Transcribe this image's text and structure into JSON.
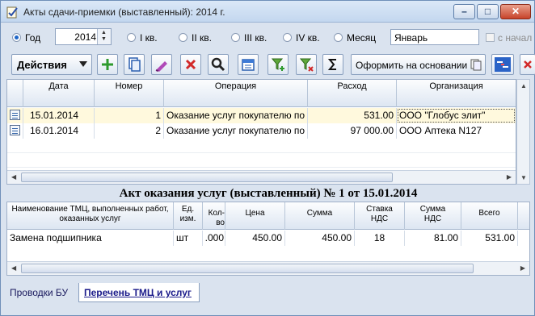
{
  "window": {
    "title": "Акты сдачи-приемки (выставленный): 2014 г.",
    "buttons": {
      "minimize": "–",
      "maximize": "□",
      "close": "✕"
    }
  },
  "filters": {
    "period_options": [
      {
        "label": "Год",
        "selected": true
      },
      {
        "label": "I кв.",
        "selected": false
      },
      {
        "label": "II кв.",
        "selected": false
      },
      {
        "label": "III кв.",
        "selected": false
      },
      {
        "label": "IV кв.",
        "selected": false
      },
      {
        "label": "Месяц",
        "selected": false
      }
    ],
    "year_value": "2014",
    "month_value": "Январь",
    "since_start_label": "с начал"
  },
  "toolbar": {
    "actions_label": "Действия",
    "basis_label": "Оформить на основании",
    "icons": [
      "add-icon",
      "copy-icon",
      "edit-icon",
      "delete-icon",
      "search-icon",
      "calendar-icon",
      "filter-add-icon",
      "filter-remove-icon",
      "sum-icon",
      "debit-credit-icon",
      "close-doc-icon"
    ]
  },
  "documents": {
    "columns": [
      "Дата",
      "Номер",
      "Операция",
      "Расход",
      "Организация"
    ],
    "rows": [
      {
        "date": "15.01.2014",
        "number": "1",
        "operation": "Оказание услуг покупателю по",
        "expense": "531.00",
        "organization": "ООО \"Глобус элит\""
      },
      {
        "date": "16.01.2014",
        "number": "2",
        "operation": "Оказание услуг покупателю по",
        "expense": "97 000.00",
        "organization": "ООО Аптека N127"
      }
    ],
    "selected_row": 0
  },
  "detail": {
    "title": "Акт оказания услуг (выставленный) № 1 от 15.01.2014",
    "columns": [
      "Наименование ТМЦ, выполненных работ, оказанных услуг",
      "Ед. изм.",
      "Кол-во",
      "Цена",
      "Сумма",
      "Ставка НДС",
      "Сумма НДС",
      "Всего"
    ],
    "rows": [
      {
        "name": "Замена подшипника",
        "unit": "шт",
        "qty": ".000",
        "price": "450.00",
        "sum": "450.00",
        "vat_rate": "18",
        "vat_sum": "81.00",
        "total": "531.00"
      }
    ]
  },
  "tabs": {
    "accounting": "Проводки БУ",
    "items": "Перечень ТМЦ и услуг",
    "active": "items"
  }
}
